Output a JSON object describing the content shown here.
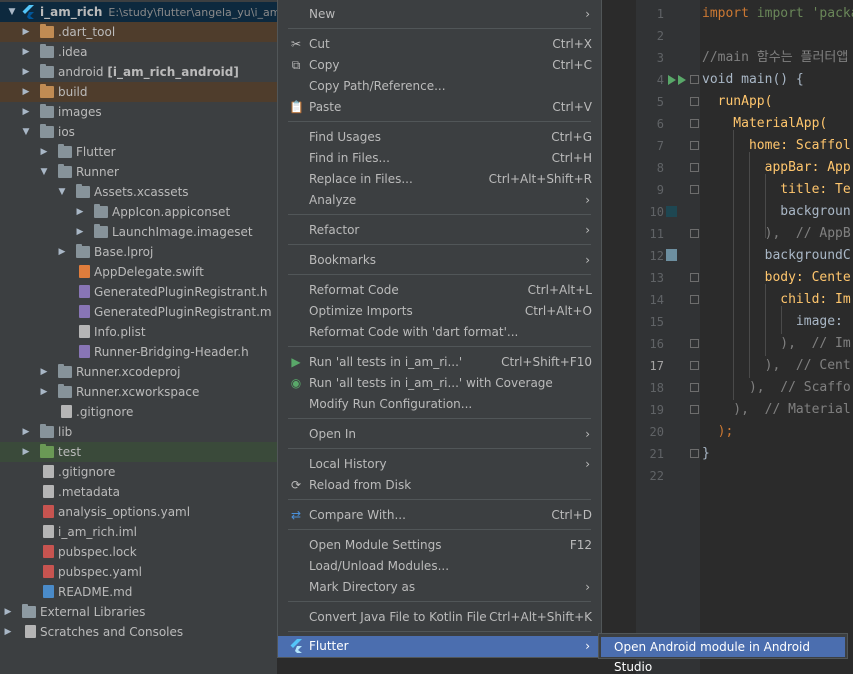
{
  "project": {
    "root_name": "i_am_rich",
    "root_path": "E:\\study\\flutter\\angela_yu\\i_am",
    "items": [
      {
        "label": ".dart_tool",
        "icon": "folder-icon"
      },
      {
        "label": ".idea",
        "icon": "settings-folder-icon"
      },
      {
        "label": "android",
        "module": "[i_am_rich_android]",
        "icon": "folder-icon"
      },
      {
        "label": "build",
        "icon": "folder-icon"
      },
      {
        "label": "images",
        "icon": "folder-icon"
      },
      {
        "label": "ios",
        "icon": "folder-icon"
      },
      {
        "label": "Flutter",
        "icon": "folder-icon"
      },
      {
        "label": "Runner",
        "icon": "folder-icon"
      },
      {
        "label": "Assets.xcassets",
        "icon": "folder-icon"
      },
      {
        "label": "AppIcon.appiconset",
        "icon": "folder-icon"
      },
      {
        "label": "LaunchImage.imageset",
        "icon": "folder-icon"
      },
      {
        "label": "Base.lproj",
        "icon": "folder-icon"
      },
      {
        "label": "AppDelegate.swift",
        "icon": "swift-file-icon"
      },
      {
        "label": "GeneratedPluginRegistrant.h",
        "icon": "c-header-file-icon"
      },
      {
        "label": "GeneratedPluginRegistrant.m",
        "icon": "c-source-file-icon"
      },
      {
        "label": "Info.plist",
        "icon": "file-icon"
      },
      {
        "label": "Runner-Bridging-Header.h",
        "icon": "c-header-file-icon"
      },
      {
        "label": "Runner.xcodeproj",
        "icon": "folder-icon"
      },
      {
        "label": "Runner.xcworkspace",
        "icon": "folder-icon"
      },
      {
        "label": ".gitignore",
        "icon": "file-icon"
      },
      {
        "label": "lib",
        "icon": "folder-icon"
      },
      {
        "label": "test",
        "icon": "folder-icon"
      },
      {
        "label": ".gitignore",
        "icon": "file-icon"
      },
      {
        "label": ".metadata",
        "icon": "file-icon"
      },
      {
        "label": "analysis_options.yaml",
        "icon": "yaml-file-icon"
      },
      {
        "label": "i_am_rich.iml",
        "icon": "iml-file-icon"
      },
      {
        "label": "pubspec.lock",
        "icon": "yaml-file-icon"
      },
      {
        "label": "pubspec.yaml",
        "icon": "yaml-file-icon"
      },
      {
        "label": "README.md",
        "icon": "markdown-file-icon"
      },
      {
        "label": "External Libraries",
        "icon": "library-icon"
      },
      {
        "label": "Scratches and Consoles",
        "icon": "scratches-icon"
      }
    ]
  },
  "menu": {
    "items": [
      {
        "label": "New",
        "shortcut": "",
        "submenu": true
      },
      {
        "label": "Cut",
        "shortcut": "Ctrl+X",
        "icon": "cut-icon"
      },
      {
        "label": "Copy",
        "shortcut": "Ctrl+C",
        "icon": "copy-icon"
      },
      {
        "label": "Copy Path/Reference...",
        "shortcut": ""
      },
      {
        "label": "Paste",
        "shortcut": "Ctrl+V",
        "icon": "paste-icon"
      },
      {
        "label": "Find Usages",
        "shortcut": "Ctrl+G"
      },
      {
        "label": "Find in Files...",
        "shortcut": "Ctrl+H"
      },
      {
        "label": "Replace in Files...",
        "shortcut": "Ctrl+Alt+Shift+R"
      },
      {
        "label": "Analyze",
        "shortcut": "",
        "submenu": true
      },
      {
        "label": "Refactor",
        "shortcut": "",
        "submenu": true
      },
      {
        "label": "Bookmarks",
        "shortcut": "",
        "submenu": true
      },
      {
        "label": "Reformat Code",
        "shortcut": "Ctrl+Alt+L"
      },
      {
        "label": "Optimize Imports",
        "shortcut": "Ctrl+Alt+O"
      },
      {
        "label": "Reformat Code with 'dart format'...",
        "shortcut": ""
      },
      {
        "label": "Run 'all tests in i_am_ri...'",
        "shortcut": "Ctrl+Shift+F10",
        "icon": "run-icon"
      },
      {
        "label": "Run 'all tests in i_am_ri...' with Coverage",
        "shortcut": "",
        "icon": "coverage-icon"
      },
      {
        "label": "Modify Run Configuration...",
        "shortcut": ""
      },
      {
        "label": "Open In",
        "shortcut": "",
        "submenu": true
      },
      {
        "label": "Local History",
        "shortcut": "",
        "submenu": true
      },
      {
        "label": "Reload from Disk",
        "shortcut": "",
        "icon": "reload-icon"
      },
      {
        "label": "Compare With...",
        "shortcut": "Ctrl+D",
        "icon": "compare-icon"
      },
      {
        "label": "Open Module Settings",
        "shortcut": "F12"
      },
      {
        "label": "Load/Unload Modules...",
        "shortcut": ""
      },
      {
        "label": "Mark Directory as",
        "shortcut": "",
        "submenu": true
      },
      {
        "label": "Convert Java File to Kotlin File",
        "shortcut": "Ctrl+Alt+Shift+K"
      },
      {
        "label": "Flutter",
        "shortcut": "",
        "submenu": true,
        "icon": "flutter-icon"
      }
    ]
  },
  "submenu": {
    "label": "Open Android module in Android Studio"
  },
  "editor": {
    "line_numbers": [
      "1",
      "2",
      "3",
      "4",
      "5",
      "6",
      "7",
      "8",
      "9",
      "10",
      "11",
      "12",
      "13",
      "14",
      "15",
      "16",
      "17",
      "18",
      "19",
      "20",
      "21",
      "22"
    ],
    "lines": [
      "import 'package:flu",
      "",
      "//main 함수는 플러터앱",
      "void main() {",
      "  runApp(",
      "    MaterialApp(",
      "      home: Scaffol",
      "        appBar: App",
      "          title: Te",
      "          backgroun",
      "        ),  // AppB",
      "        backgroundC",
      "        body: Cente",
      "          child: Im",
      "            image: ",
      "          ),  // Im",
      "        ),  // Cent",
      "      ),  // Scaffo",
      "    ),  // Material",
      "  );",
      "}",
      ""
    ]
  },
  "colors": {
    "menu_bg": "#3c3f41",
    "selection": "#4b6eaf",
    "editor_bg": "#2b2b2b",
    "keyword": "#cc7832",
    "string": "#6a8759",
    "comment": "#808080",
    "function": "#ffc66d"
  }
}
